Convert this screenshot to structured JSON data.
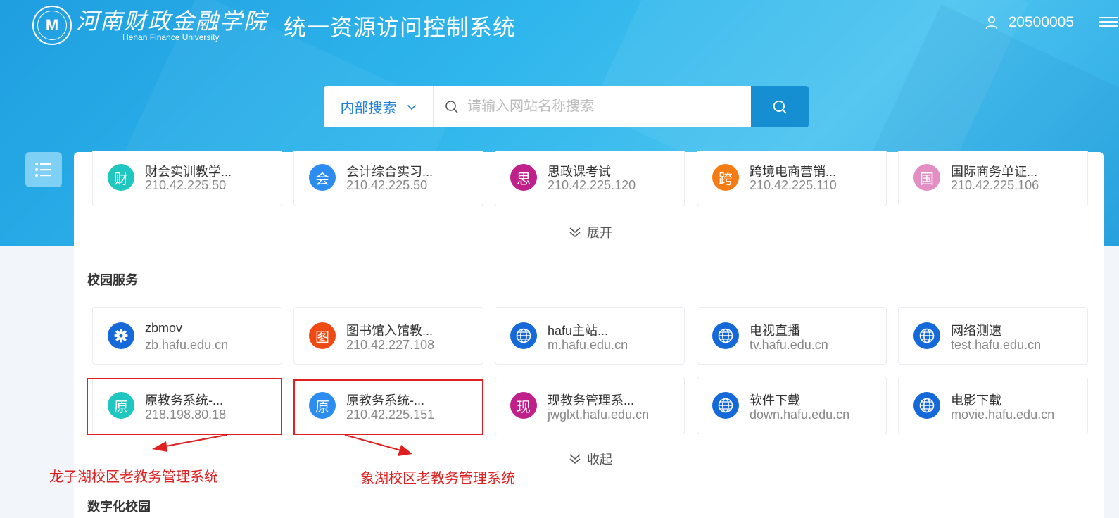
{
  "header": {
    "logo_emblem": "M",
    "logo_cn": "河南财政金融学院",
    "logo_en": "Henan Finance University",
    "system_title": "统一资源访问控制系统",
    "user_id": "20500005"
  },
  "search": {
    "type_label": "内部搜索",
    "placeholder": "请输入网站名称搜索"
  },
  "top_cards": [
    {
      "badge": "财",
      "color": "#1fc7c0",
      "name": "财会实训教学...",
      "addr": "210.42.225.50"
    },
    {
      "badge": "会",
      "color": "#2d8cf0",
      "name": "会计综合实习...",
      "addr": "210.42.225.50"
    },
    {
      "badge": "思",
      "color": "#c0208a",
      "name": "思政课考试",
      "addr": "210.42.225.120"
    },
    {
      "badge": "跨",
      "color": "#f57c15",
      "name": "跨境电商营销...",
      "addr": "210.42.225.110"
    },
    {
      "badge": "国",
      "color": "#e38fc4",
      "name": "国际商务单证...",
      "addr": "210.42.225.106"
    }
  ],
  "expand_label": "展开",
  "campus": {
    "title": "校园服务",
    "row1": [
      {
        "badge": "gear",
        "color": "#1669d8",
        "name": "zbmov",
        "addr": "zb.hafu.edu.cn"
      },
      {
        "badge": "图",
        "color": "#f04a14",
        "name": "图书馆入馆教...",
        "addr": "210.42.227.108"
      },
      {
        "badge": "globe",
        "color": "#1669d8",
        "name": "hafu主站...",
        "addr": "m.hafu.edu.cn"
      },
      {
        "badge": "globe",
        "color": "#1669d8",
        "name": "电视直播",
        "addr": "tv.hafu.edu.cn"
      },
      {
        "badge": "globe",
        "color": "#1669d8",
        "name": "网络测速",
        "addr": "test.hafu.edu.cn"
      }
    ],
    "row2": [
      {
        "badge": "原",
        "color": "#1fc7c0",
        "name": "原教务系统-...",
        "addr": "218.198.80.18"
      },
      {
        "badge": "原",
        "color": "#2d8cf0",
        "name": "原教务系统-...",
        "addr": "210.42.225.151"
      },
      {
        "badge": "现",
        "color": "#c0208a",
        "name": "现教务管理系...",
        "addr": "jwglxt.hafu.edu.cn"
      },
      {
        "badge": "globe",
        "color": "#1669d8",
        "name": "软件下载",
        "addr": "down.hafu.edu.cn"
      },
      {
        "badge": "globe",
        "color": "#1669d8",
        "name": "电影下载",
        "addr": "movie.hafu.edu.cn"
      }
    ],
    "collapse_label": "收起"
  },
  "next_section_title": "数字化校园",
  "annotations": {
    "left": "龙子湖校区老教务管理系统",
    "right": "象湖校区老教务管理系统",
    "color": "#e02020"
  }
}
